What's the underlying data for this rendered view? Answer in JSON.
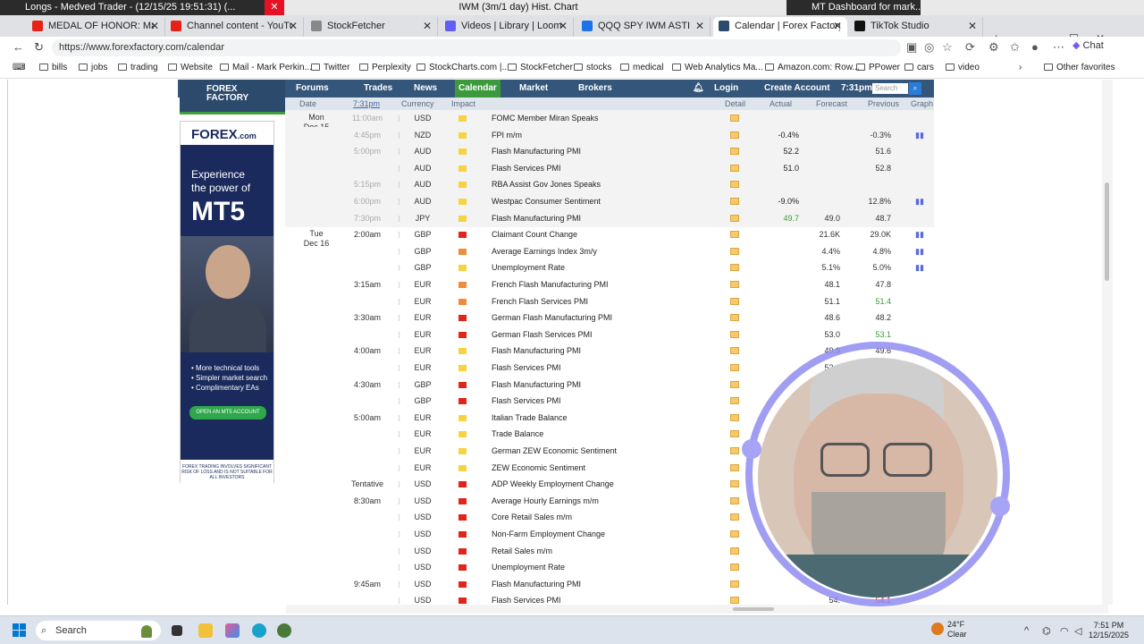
{
  "window_strip": {
    "left_title": "Longs - Medved Trader - (12/15/25 19:51:31) (...",
    "center_title": "IWM (3m/1 day) Hist. Chart",
    "right_title": "MT Dashboard for mark..."
  },
  "tabs": [
    {
      "label": "MEDAL OF HONOR: Marine Sayi...",
      "color": "#e62117"
    },
    {
      "label": "Channel content - YouTube Studio",
      "color": "#e62117"
    },
    {
      "label": "StockFetcher",
      "color": "#888888"
    },
    {
      "label": "Videos | Library | Loom",
      "color": "#625df5"
    },
    {
      "label": "QQQ SPY IWM ASTI",
      "color": "#1a73e8"
    },
    {
      "label": "Calendar | Forex Factory",
      "color": "#2c4a6b",
      "active": true
    },
    {
      "label": "TikTok Studio",
      "color": "#111111"
    }
  ],
  "address": {
    "url": "https://www.forexfactory.com/calendar",
    "chat_label": "Chat"
  },
  "bookmarks": [
    "bills",
    "jobs",
    "trading",
    "Website",
    "Mail - Mark Perkin...",
    "Twitter",
    "Perplexity",
    "StockCharts.com |...",
    "StockFetcher",
    "stocks",
    "medical",
    "Web Analytics Ma...",
    "Amazon.com: Row...",
    "PPower",
    "cars",
    "video",
    "Other favorites"
  ],
  "ff_nav": {
    "logo_line1": "FOREX",
    "logo_line2": "FACTORY",
    "items": [
      "Forums",
      "Trades",
      "News",
      "Calendar",
      "Market",
      "Brokers"
    ],
    "login": "Login",
    "create": "Create Account",
    "time": "7:31pm",
    "search_placeholder": "Search"
  },
  "ad": {
    "brand": "FOREX",
    "brand_suffix": ".com",
    "line1": "Experience",
    "line2": "the power of",
    "big": "MT5",
    "bullets": [
      "• More technical tools",
      "• Simpler market search",
      "• Complimentary EAs"
    ],
    "button": "OPEN AN MT5 ACCOUNT",
    "disclaimer": "FOREX TRADING INVOLVES SIGNIFICANT RISK OF LOSS AND IS NOT SUITABLE FOR ALL INVESTORS"
  },
  "table_header": {
    "date": "Date",
    "time": "7:31pm",
    "currency": "Currency",
    "impact": "Impact",
    "detail": "Detail",
    "actual": "Actual",
    "forecast": "Forecast",
    "previous": "Previous",
    "graph": "Graph"
  },
  "impact_colors": {
    "low": "#f5d442",
    "medium": "#f08c3a",
    "high": "#e0261b"
  },
  "rows": [
    {
      "date": "Mon\nDec 15",
      "time": "11:00am",
      "past": true,
      "currency": "USD",
      "impact": "low",
      "event": "FOMC Member Miran Speaks",
      "actual": "",
      "forecast": "",
      "previous": "",
      "graph": false,
      "shade": true
    },
    {
      "date": "",
      "time": "4:45pm",
      "past": true,
      "currency": "NZD",
      "impact": "low",
      "event": "FPI m/m",
      "actual": "-0.4%",
      "forecast": "",
      "previous": "-0.3%",
      "graph": true,
      "shade": true
    },
    {
      "date": "",
      "time": "5:00pm",
      "past": true,
      "currency": "AUD",
      "impact": "low",
      "event": "Flash Manufacturing PMI",
      "actual": "52.2",
      "forecast": "",
      "previous": "51.6",
      "graph": false,
      "shade": true
    },
    {
      "date": "",
      "time": "",
      "past": true,
      "currency": "AUD",
      "impact": "low",
      "event": "Flash Services PMI",
      "actual": "51.0",
      "forecast": "",
      "previous": "52.8",
      "graph": false,
      "shade": true
    },
    {
      "date": "",
      "time": "5:15pm",
      "past": true,
      "currency": "AUD",
      "impact": "low",
      "event": "RBA Assist Gov Jones Speaks",
      "actual": "",
      "forecast": "",
      "previous": "",
      "graph": false,
      "shade": true
    },
    {
      "date": "",
      "time": "6:00pm",
      "past": true,
      "currency": "AUD",
      "impact": "low",
      "event": "Westpac Consumer Sentiment",
      "actual": "-9.0%",
      "forecast": "",
      "previous": "12.8%",
      "graph": true,
      "shade": true
    },
    {
      "date": "",
      "time": "7:30pm",
      "past": true,
      "currency": "JPY",
      "impact": "low",
      "event": "Flash Manufacturing PMI",
      "actual": "49.7",
      "actual_color": "green",
      "forecast": "49.0",
      "previous": "48.7",
      "graph": false,
      "shade": true
    },
    {
      "date": "Tue\nDec 16",
      "time": "2:00am",
      "past": false,
      "currency": "GBP",
      "impact": "high",
      "event": "Claimant Count Change",
      "actual": "",
      "forecast": "21.6K",
      "previous": "29.0K",
      "graph": true
    },
    {
      "date": "",
      "time": "",
      "past": false,
      "currency": "GBP",
      "impact": "medium",
      "event": "Average Earnings Index 3m/y",
      "actual": "",
      "forecast": "4.4%",
      "previous": "4.8%",
      "graph": true
    },
    {
      "date": "",
      "time": "",
      "past": false,
      "currency": "GBP",
      "impact": "low",
      "event": "Unemployment Rate",
      "actual": "",
      "forecast": "5.1%",
      "previous": "5.0%",
      "graph": true
    },
    {
      "date": "",
      "time": "3:15am",
      "past": false,
      "currency": "EUR",
      "impact": "medium",
      "event": "French Flash Manufacturing PMI",
      "actual": "",
      "forecast": "48.1",
      "previous": "47.8",
      "graph": false
    },
    {
      "date": "",
      "time": "",
      "past": false,
      "currency": "EUR",
      "impact": "medium",
      "event": "French Flash Services PMI",
      "actual": "",
      "forecast": "51.1",
      "previous": "51.4",
      "prev_color": "green",
      "graph": false
    },
    {
      "date": "",
      "time": "3:30am",
      "past": false,
      "currency": "EUR",
      "impact": "high",
      "event": "German Flash Manufacturing PMI",
      "actual": "",
      "forecast": "48.6",
      "previous": "48.2",
      "graph": false
    },
    {
      "date": "",
      "time": "",
      "past": false,
      "currency": "EUR",
      "impact": "high",
      "event": "German Flash Services PMI",
      "actual": "",
      "forecast": "53.0",
      "previous": "53.1",
      "prev_color": "green",
      "graph": false
    },
    {
      "date": "",
      "time": "4:00am",
      "past": false,
      "currency": "EUR",
      "impact": "low",
      "event": "Flash Manufacturing PMI",
      "actual": "",
      "forecast": "49.9",
      "previous": "49.6",
      "graph": false
    },
    {
      "date": "",
      "time": "",
      "past": false,
      "currency": "EUR",
      "impact": "low",
      "event": "Flash Services PMI",
      "actual": "",
      "forecast": "53.3",
      "previous": "",
      "graph": false
    },
    {
      "date": "",
      "time": "4:30am",
      "past": false,
      "currency": "GBP",
      "impact": "high",
      "event": "Flash Manufacturing PMI",
      "actual": "",
      "forecast": "",
      "previous": "",
      "graph": false
    },
    {
      "date": "",
      "time": "",
      "past": false,
      "currency": "GBP",
      "impact": "high",
      "event": "Flash Services PMI",
      "actual": "",
      "forecast": "",
      "previous": "",
      "graph": false
    },
    {
      "date": "",
      "time": "5:00am",
      "past": false,
      "currency": "EUR",
      "impact": "low",
      "event": "Italian Trade Balance",
      "actual": "",
      "forecast": "",
      "previous": "",
      "graph": false
    },
    {
      "date": "",
      "time": "",
      "past": false,
      "currency": "EUR",
      "impact": "low",
      "event": "Trade Balance",
      "actual": "",
      "forecast": "",
      "previous": "",
      "graph": false
    },
    {
      "date": "",
      "time": "",
      "past": false,
      "currency": "EUR",
      "impact": "low",
      "event": "German ZEW Economic Sentiment",
      "actual": "",
      "forecast": "",
      "previous": "",
      "graph": false
    },
    {
      "date": "",
      "time": "",
      "past": false,
      "currency": "EUR",
      "impact": "low",
      "event": "ZEW Economic Sentiment",
      "actual": "",
      "forecast": "",
      "previous": "",
      "graph": false
    },
    {
      "date": "",
      "time": "Tentative",
      "past": false,
      "currency": "USD",
      "impact": "high",
      "event": "ADP Weekly Employment Change",
      "actual": "",
      "forecast": "",
      "previous": "",
      "graph": false
    },
    {
      "date": "",
      "time": "8:30am",
      "past": false,
      "currency": "USD",
      "impact": "high",
      "event": "Average Hourly Earnings m/m",
      "actual": "",
      "forecast": "",
      "previous": "",
      "graph": false
    },
    {
      "date": "",
      "time": "",
      "past": false,
      "currency": "USD",
      "impact": "high",
      "event": "Core Retail Sales m/m",
      "actual": "",
      "forecast": "",
      "previous": "",
      "graph": false
    },
    {
      "date": "",
      "time": "",
      "past": false,
      "currency": "USD",
      "impact": "high",
      "event": "Non-Farm Employment Change",
      "actual": "",
      "forecast": "",
      "previous": "",
      "graph": false
    },
    {
      "date": "",
      "time": "",
      "past": false,
      "currency": "USD",
      "impact": "high",
      "event": "Retail Sales m/m",
      "actual": "",
      "forecast": "",
      "previous": "",
      "graph": false
    },
    {
      "date": "",
      "time": "",
      "past": false,
      "currency": "USD",
      "impact": "high",
      "event": "Unemployment Rate",
      "actual": "",
      "forecast": "",
      "previous": "",
      "graph": false
    },
    {
      "date": "",
      "time": "9:45am",
      "past": false,
      "currency": "USD",
      "impact": "high",
      "event": "Flash Manufacturing PMI",
      "actual": "",
      "forecast": "52.",
      "previous": "",
      "graph": false
    },
    {
      "date": "",
      "time": "",
      "past": false,
      "currency": "USD",
      "impact": "high",
      "event": "Flash Services PMI",
      "actual": "",
      "forecast": "54.",
      "previous": "54.1",
      "prev_color": "red",
      "graph": false
    }
  ],
  "taskbar": {
    "search_placeholder": "Search",
    "weather_temp": "24°F",
    "weather_desc": "Clear",
    "time": "7:51 PM",
    "date": "12/15/2025"
  }
}
